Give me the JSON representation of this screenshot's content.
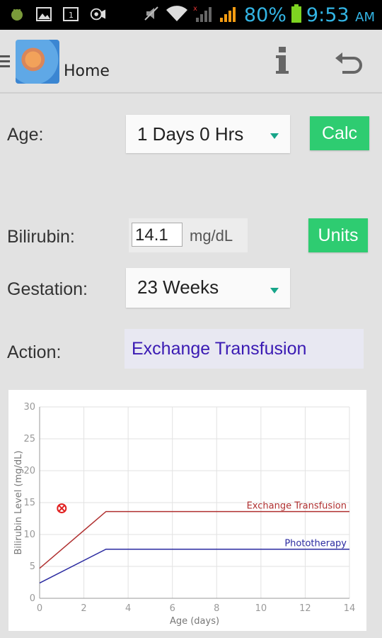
{
  "status_bar": {
    "battery": "80%",
    "time": "9:53",
    "ampm": "AM"
  },
  "action_bar": {
    "title": "Home",
    "icons": [
      "menu-icon",
      "app-logo",
      "info-icon",
      "undo-icon"
    ]
  },
  "form": {
    "age_label": "Age:",
    "age_value": "1 Days 0 Hrs",
    "calc_label": "Calc",
    "bilirubin_label": "Bilirubin:",
    "bilirubin_value": "14.1",
    "bilirubin_unit": "mg/dL",
    "units_label": "Units",
    "gestation_label": "Gestation:",
    "gestation_value": "23 Weeks",
    "action_label": "Action:",
    "action_value": "Exchange Transfusion"
  },
  "colors": {
    "accent_green": "#2ecc71",
    "spinner_arrow": "#17a589",
    "action_text": "#3a1ab3",
    "exchange_line": "#b03030",
    "photo_line": "#2a2aa0",
    "marker": "#e02020",
    "status_blue": "#33b5e5"
  },
  "chart_data": {
    "type": "line",
    "xlabel": "Age (days)",
    "ylabel": "Bilirubin Level (mg/dL)",
    "xlim": [
      0,
      14
    ],
    "ylim": [
      0,
      30
    ],
    "xticks": [
      0,
      2,
      4,
      6,
      8,
      10,
      12,
      14
    ],
    "yticks": [
      0,
      5,
      10,
      15,
      20,
      25,
      30
    ],
    "grid": true,
    "series": [
      {
        "name": "Exchange Transfusion",
        "x": [
          0,
          3,
          14
        ],
        "y": [
          4.7,
          13.6,
          13.6
        ]
      },
      {
        "name": "Phototherapy",
        "x": [
          0,
          3,
          14
        ],
        "y": [
          2.4,
          7.7,
          7.7
        ]
      }
    ],
    "point": {
      "x": 1,
      "y": 14.1
    }
  }
}
